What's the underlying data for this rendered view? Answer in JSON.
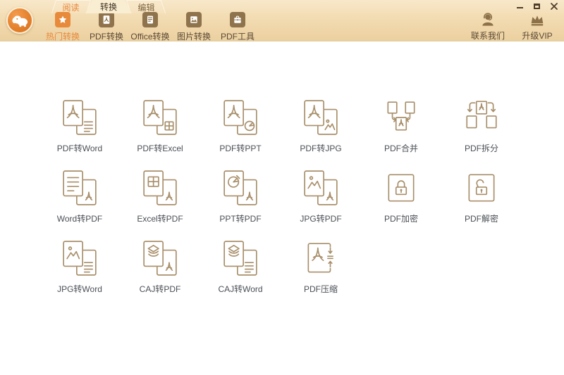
{
  "titlebar": {
    "tabs": [
      {
        "label": "阅读"
      },
      {
        "label": "转换",
        "active": true
      },
      {
        "label": "编辑"
      }
    ]
  },
  "toolbar": {
    "items": [
      {
        "label": "热门转换",
        "icon": "star-icon",
        "active": true
      },
      {
        "label": "PDF转换",
        "icon": "pdf-file-icon"
      },
      {
        "label": "Office转换",
        "icon": "office-doc-icon"
      },
      {
        "label": "图片转换",
        "icon": "image-file-icon"
      },
      {
        "label": "PDF工具",
        "icon": "toolbox-icon"
      }
    ],
    "right": [
      {
        "label": "联系我们",
        "icon": "headset-person-icon"
      },
      {
        "label": "升级VIP",
        "icon": "crown-icon"
      }
    ]
  },
  "grid": {
    "items": [
      {
        "label": "PDF转Word",
        "icon": "pdf-to-word-icon",
        "icon_ref": "#i-pdf2word"
      },
      {
        "label": "PDF转Excel",
        "icon": "pdf-to-excel-icon",
        "icon_ref": "#i-pdf2excel"
      },
      {
        "label": "PDF转PPT",
        "icon": "pdf-to-ppt-icon",
        "icon_ref": "#i-pdf2ppt"
      },
      {
        "label": "PDF转JPG",
        "icon": "pdf-to-jpg-icon",
        "icon_ref": "#i-pdf2jpg"
      },
      {
        "label": "PDF合并",
        "icon": "pdf-merge-icon",
        "icon_ref": "#i-merge"
      },
      {
        "label": "PDF拆分",
        "icon": "pdf-split-icon",
        "icon_ref": "#i-split"
      },
      {
        "label": "Word转PDF",
        "icon": "word-to-pdf-icon",
        "icon_ref": "#i-word2pdf"
      },
      {
        "label": "Excel转PDF",
        "icon": "excel-to-pdf-icon",
        "icon_ref": "#i-excel2pdf"
      },
      {
        "label": "PPT转PDF",
        "icon": "ppt-to-pdf-icon",
        "icon_ref": "#i-ppt2pdf"
      },
      {
        "label": "JPG转PDF",
        "icon": "jpg-to-pdf-icon",
        "icon_ref": "#i-jpg2pdf"
      },
      {
        "label": "PDF加密",
        "icon": "pdf-encrypt-icon",
        "icon_ref": "#i-lock"
      },
      {
        "label": "PDF解密",
        "icon": "pdf-decrypt-icon",
        "icon_ref": "#i-unlock"
      },
      {
        "label": "JPG转Word",
        "icon": "jpg-to-word-icon",
        "icon_ref": "#i-jpg2word"
      },
      {
        "label": "CAJ转PDF",
        "icon": "caj-to-pdf-icon",
        "icon_ref": "#i-caj2pdf"
      },
      {
        "label": "CAJ转Word",
        "icon": "caj-to-word-icon",
        "icon_ref": "#i-caj2word"
      },
      {
        "label": "PDF压缩",
        "icon": "pdf-compress-icon",
        "icon_ref": "#i-compress"
      }
    ]
  },
  "colors": {
    "accent_orange": "#e78a3c",
    "toolbar_icon_brown": "#8f734c",
    "solid_icon_brown": "#8d7148",
    "grid_line_tan": "#a88f6a",
    "grid_label": "#4b5056",
    "header_top": "#f8e8ca",
    "header_bottom": "#ecd0a0",
    "active_tab_fill": "#f9edd2"
  }
}
